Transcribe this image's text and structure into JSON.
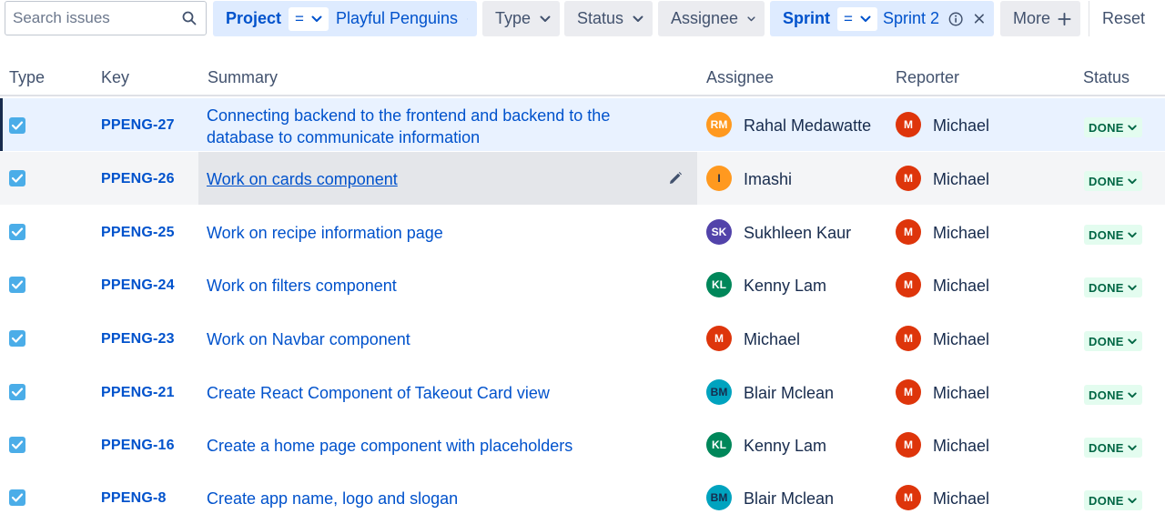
{
  "search": {
    "placeholder": "Search issues",
    "value": ""
  },
  "filters": {
    "project": {
      "label": "Project",
      "operator": "=",
      "value": "Playful Penguins"
    },
    "type": {
      "label": "Type"
    },
    "status": {
      "label": "Status"
    },
    "assignee": {
      "label": "Assignee"
    },
    "sprint": {
      "label": "Sprint",
      "operator": "=",
      "value": "Sprint 2"
    },
    "more": {
      "label": "More"
    },
    "reset": {
      "label": "Reset"
    }
  },
  "columns": {
    "type": "Type",
    "key": "Key",
    "summary": "Summary",
    "assignee": "Assignee",
    "reporter": "Reporter",
    "status": "Status"
  },
  "colors": {
    "link": "#0052cc",
    "done_bg": "#e3fcef",
    "done_text": "#006644",
    "checkbox": "#4bade8",
    "selected_row": "#e9f2ff"
  },
  "issues": [
    {
      "key": "PPENG-27",
      "summary_line1": "Connecting backend to the frontend and backend to the",
      "summary_line2": "database to communicate information",
      "assignee": "Rahal Medawatte",
      "assignee_initials": "RM",
      "assignee_color": "#ff991f",
      "reporter": "Michael",
      "reporter_initials": "M",
      "reporter_color": "#de350b",
      "status": "DONE"
    },
    {
      "key": "PPENG-26",
      "summary": "Work on cards component",
      "assignee": "Imashi",
      "assignee_initials": "I",
      "assignee_color": "#ff991f",
      "reporter": "Michael",
      "reporter_initials": "M",
      "reporter_color": "#de350b",
      "status": "DONE"
    },
    {
      "key": "PPENG-25",
      "summary": "Work on recipe information page",
      "assignee": "Sukhleen Kaur",
      "assignee_initials": "SK",
      "assignee_color": "#5243aa",
      "reporter": "Michael",
      "reporter_initials": "M",
      "reporter_color": "#de350b",
      "status": "DONE"
    },
    {
      "key": "PPENG-24",
      "summary": "Work on filters component",
      "assignee": "Kenny Lam",
      "assignee_initials": "KL",
      "assignee_color": "#00875a",
      "reporter": "Michael",
      "reporter_initials": "M",
      "reporter_color": "#de350b",
      "status": "DONE"
    },
    {
      "key": "PPENG-23",
      "summary": "Work on Navbar component",
      "assignee": "Michael",
      "assignee_initials": "M",
      "assignee_color": "#de350b",
      "reporter": "Michael",
      "reporter_initials": "M",
      "reporter_color": "#de350b",
      "status": "DONE"
    },
    {
      "key": "PPENG-21",
      "summary": "Create React Component of Takeout Card view",
      "assignee": "Blair Mclean",
      "assignee_initials": "BM",
      "assignee_color": "#00a3bf",
      "reporter": "Michael",
      "reporter_initials": "M",
      "reporter_color": "#de350b",
      "status": "DONE"
    },
    {
      "key": "PPENG-16",
      "summary": "Create a home page component with placeholders",
      "assignee": "Kenny Lam",
      "assignee_initials": "KL",
      "assignee_color": "#00875a",
      "reporter": "Michael",
      "reporter_initials": "M",
      "reporter_color": "#de350b",
      "status": "DONE"
    },
    {
      "key": "PPENG-8",
      "summary": "Create app name, logo and slogan",
      "assignee": "Blair Mclean",
      "assignee_initials": "BM",
      "assignee_color": "#00a3bf",
      "reporter": "Michael",
      "reporter_initials": "M",
      "reporter_color": "#de350b",
      "status": "DONE"
    }
  ]
}
